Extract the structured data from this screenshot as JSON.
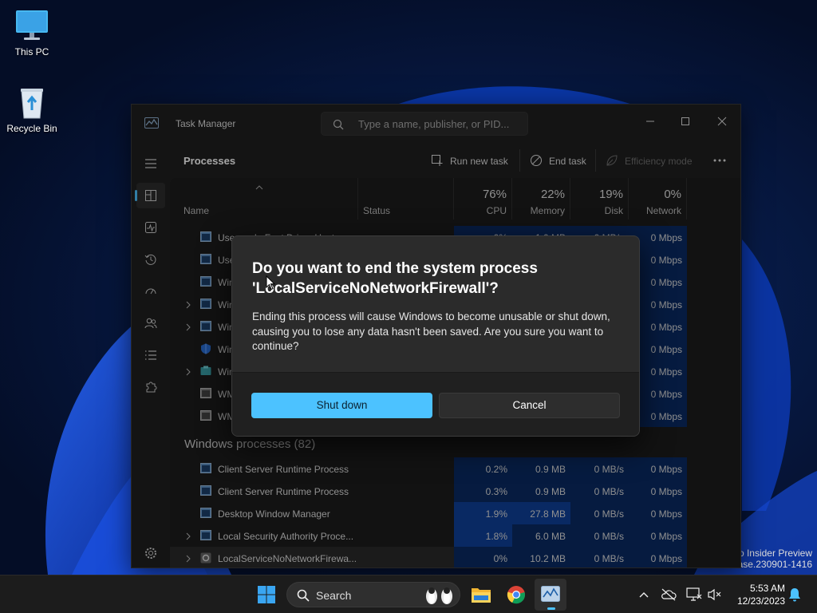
{
  "desktop": {
    "icons": [
      {
        "label": "This PC",
        "icon": "monitor-icon"
      },
      {
        "label": "Recycle Bin",
        "icon": "recycle-bin-icon"
      }
    ],
    "watermark": {
      "line1": "o Insider Preview",
      "line2": "ease.230901-1416"
    }
  },
  "task_manager": {
    "title": "Task Manager",
    "search_placeholder": "Type a name, publisher, or PID...",
    "heading": "Processes",
    "toolbar": {
      "run_new_task": "Run new task",
      "end_task": "End task",
      "efficiency_mode": "Efficiency mode"
    },
    "columns": {
      "name": "Name",
      "status": "Status",
      "cpu": {
        "pct": "76%",
        "label": "CPU"
      },
      "memory": {
        "pct": "22%",
        "label": "Memory"
      },
      "disk": {
        "pct": "19%",
        "label": "Disk"
      },
      "network": {
        "pct": "0%",
        "label": "Network"
      }
    },
    "top_rows": [
      {
        "name": "Usermode Font Driver Host",
        "cpu": "0%",
        "memory": "1.0 MB",
        "disk": "0 MB/s",
        "network": "0 Mbps",
        "expandable": false
      },
      {
        "name": "Use",
        "network": "0 Mbps",
        "expandable": false
      },
      {
        "name": "Win",
        "network": "0 Mbps",
        "expandable": false
      },
      {
        "name": "Win",
        "network": "0 Mbps",
        "expandable": true
      },
      {
        "name": "Win",
        "network": "0 Mbps",
        "expandable": true
      },
      {
        "name": "Win",
        "network": "0 Mbps",
        "expandable": false
      },
      {
        "name": "Win",
        "network": "0 Mbps",
        "expandable": true
      },
      {
        "name": "WM",
        "network": "0 Mbps",
        "expandable": false
      },
      {
        "name": "WM",
        "network": "0 Mbps",
        "expandable": false
      }
    ],
    "group_heading": "Windows processes (82)",
    "windows_rows": [
      {
        "name": "Client Server Runtime Process",
        "cpu": "0.2%",
        "memory": "0.9 MB",
        "disk": "0 MB/s",
        "network": "0 Mbps",
        "expandable": false
      },
      {
        "name": "Client Server Runtime Process",
        "cpu": "0.3%",
        "memory": "0.9 MB",
        "disk": "0 MB/s",
        "network": "0 Mbps",
        "expandable": false
      },
      {
        "name": "Desktop Window Manager",
        "cpu": "1.9%",
        "memory": "27.8 MB",
        "disk": "0 MB/s",
        "network": "0 Mbps",
        "expandable": false
      },
      {
        "name": "Local Security Authority Proce...",
        "cpu": "1.8%",
        "memory": "6.0 MB",
        "disk": "0 MB/s",
        "network": "0 Mbps",
        "expandable": true
      },
      {
        "name": "LocalServiceNoNetworkFirewa...",
        "cpu": "0%",
        "memory": "10.2 MB",
        "disk": "0 MB/s",
        "network": "0 Mbps",
        "expandable": true
      }
    ]
  },
  "dialog": {
    "title_line1": "Do you want to end the system process",
    "title_line2": "'LocalServiceNoNetworkFirewall'?",
    "body": "Ending this process will cause Windows to become unusable or shut down, causing you to lose any data hasn't been saved. Are you sure you want to continue?",
    "primary_button": "Shut down",
    "secondary_button": "Cancel"
  },
  "taskbar": {
    "search_label": "Search",
    "time": "5:53 AM",
    "date": "12/23/2023"
  },
  "colors": {
    "accent": "#4cc2ff",
    "heat_low": "#0a2a63",
    "heat_high": "#0f3f98"
  }
}
